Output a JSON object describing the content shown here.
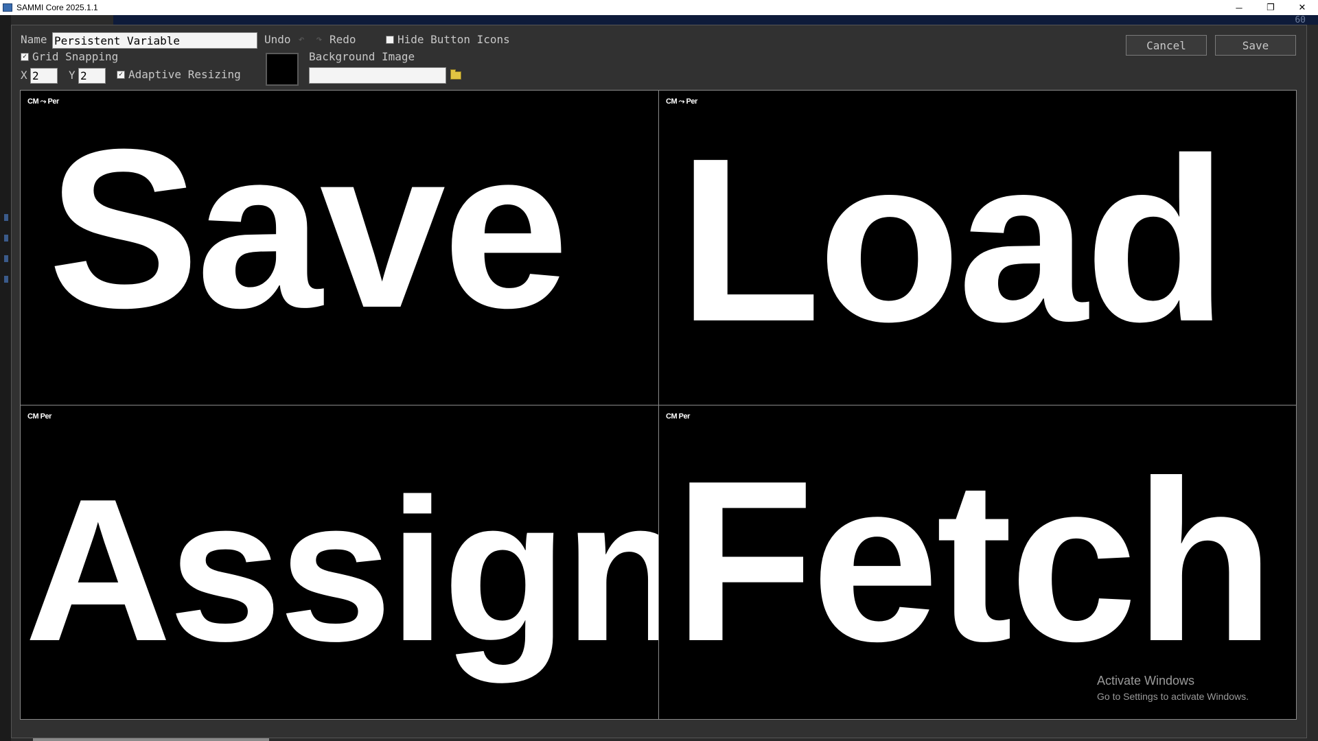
{
  "window": {
    "title": "SAMMI Core 2025.1.1",
    "controls": {
      "minimize": "─",
      "restore": "❐",
      "close": "✕"
    },
    "behind_number": "60"
  },
  "toolbar": {
    "name_label": "Name",
    "name_value": "Persistent Variable",
    "undo_label": "Undo",
    "redo_label": "Redo",
    "hide_icons_label": "Hide Button Icons",
    "hide_icons_checked": false,
    "grid_snapping_label": "Grid Snapping",
    "grid_snapping_checked": true,
    "x_label": "X",
    "x_value": "2",
    "y_label": "Y",
    "y_value": "2",
    "adaptive_resizing_label": "Adaptive Resizing",
    "adaptive_resizing_checked": true,
    "background_color": "#000000",
    "background_image_label": "Background Image",
    "background_image_value": "",
    "cancel_label": "Cancel",
    "save_label": "Save"
  },
  "buttons": [
    {
      "label": "Save",
      "badge": "CM ⤳ Per"
    },
    {
      "label": "Load",
      "badge": "CM ⤳ Per"
    },
    {
      "label": "Assign",
      "badge": "CM Per"
    },
    {
      "label": "Fetch",
      "badge": "CM Per"
    }
  ],
  "watermark": {
    "line1": "Activate Windows",
    "line2": "Go to Settings to activate Windows."
  },
  "icons": {
    "undo": "undo-icon",
    "redo": "redo-icon",
    "folder": "folder-icon",
    "app": "app-icon"
  }
}
